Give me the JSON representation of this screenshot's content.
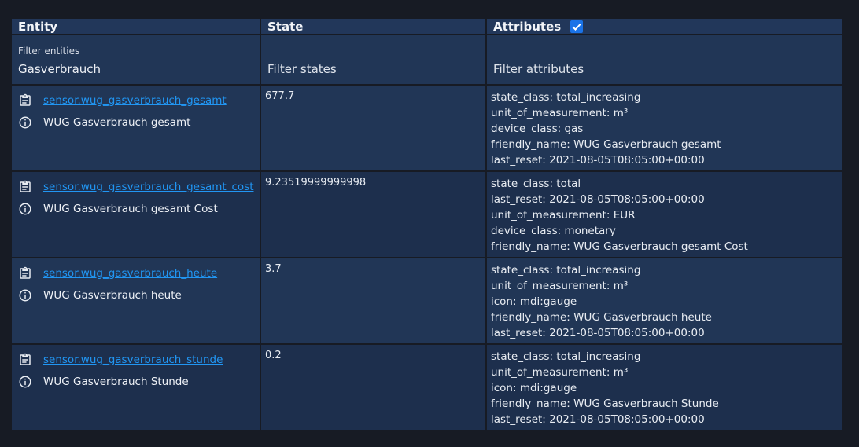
{
  "header": {
    "entity": "Entity",
    "state": "State",
    "attributes": "Attributes",
    "attributes_checked": true
  },
  "filters": {
    "entities_label": "Filter entities",
    "entities_value": "Gasverbrauch",
    "states_placeholder": "Filter states",
    "attributes_placeholder": "Filter attributes"
  },
  "rows": [
    {
      "entity_id": "sensor.wug_gasverbrauch_gesamt",
      "friendly_name": "WUG Gasverbrauch gesamt",
      "state": "677.7",
      "attributes": [
        "state_class: total_increasing",
        "unit_of_measurement: m³",
        "device_class: gas",
        "friendly_name: WUG Gasverbrauch gesamt",
        "last_reset: 2021-08-05T08:05:00+00:00"
      ]
    },
    {
      "entity_id": "sensor.wug_gasverbrauch_gesamt_cost",
      "friendly_name": "WUG Gasverbrauch gesamt Cost",
      "state": "9.23519999999998",
      "attributes": [
        "state_class: total",
        "last_reset: 2021-08-05T08:05:00+00:00",
        "unit_of_measurement: EUR",
        "device_class: monetary",
        "friendly_name: WUG Gasverbrauch gesamt Cost"
      ]
    },
    {
      "entity_id": "sensor.wug_gasverbrauch_heute",
      "friendly_name": "WUG Gasverbrauch heute",
      "state": "3.7",
      "attributes": [
        "state_class: total_increasing",
        "unit_of_measurement: m³",
        "icon: mdi:gauge",
        "friendly_name: WUG Gasverbrauch heute",
        "last_reset: 2021-08-05T08:05:00+00:00"
      ]
    },
    {
      "entity_id": "sensor.wug_gasverbrauch_stunde",
      "friendly_name": "WUG Gasverbrauch Stunde",
      "state": "0.2",
      "attributes": [
        "state_class: total_increasing",
        "unit_of_measurement: m³",
        "icon: mdi:gauge",
        "friendly_name: WUG Gasverbrauch Stunde",
        "last_reset: 2021-08-05T08:05:00+00:00"
      ]
    }
  ],
  "icons": {
    "copy": "clipboard-icon",
    "info": "info-circle-icon",
    "check": "checkmark-icon"
  },
  "colors": {
    "link": "#2196f3",
    "checkbox": "#1a73e8",
    "cell": "#213656",
    "cell_alt": "#1d2f4d",
    "background": "#171b24"
  }
}
